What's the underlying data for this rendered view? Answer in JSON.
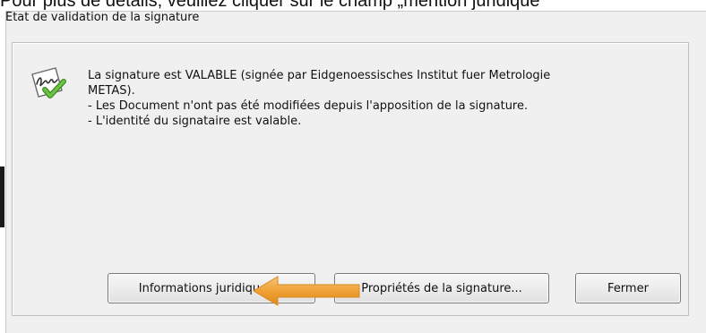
{
  "document": {
    "cropped_text": "Pour plus de détails, veuillez cliquer sur le champ „mention juridique\""
  },
  "dialog": {
    "title": "Etat de validation de la signature",
    "icon": "signature-valid-icon",
    "message_lines": [
      "La signature est VALABLE (signée par Eidgenoessisches Institut fuer Metrologie",
      "METAS).",
      "- Les Document n'ont pas été modifiées depuis l'apposition de la signature.",
      "- L'identité du signataire est valable."
    ],
    "buttons": {
      "legal_info": "Informations juridiques...",
      "signature_properties": "Propriétés de la signature...",
      "close": "Fermer"
    }
  },
  "annotation": {
    "arrow_icon": "left-arrow-icon",
    "arrow_color": "#f0a035"
  },
  "colors": {
    "dialog_bg": "#f0f0f0",
    "check_green": "#5aa832"
  }
}
